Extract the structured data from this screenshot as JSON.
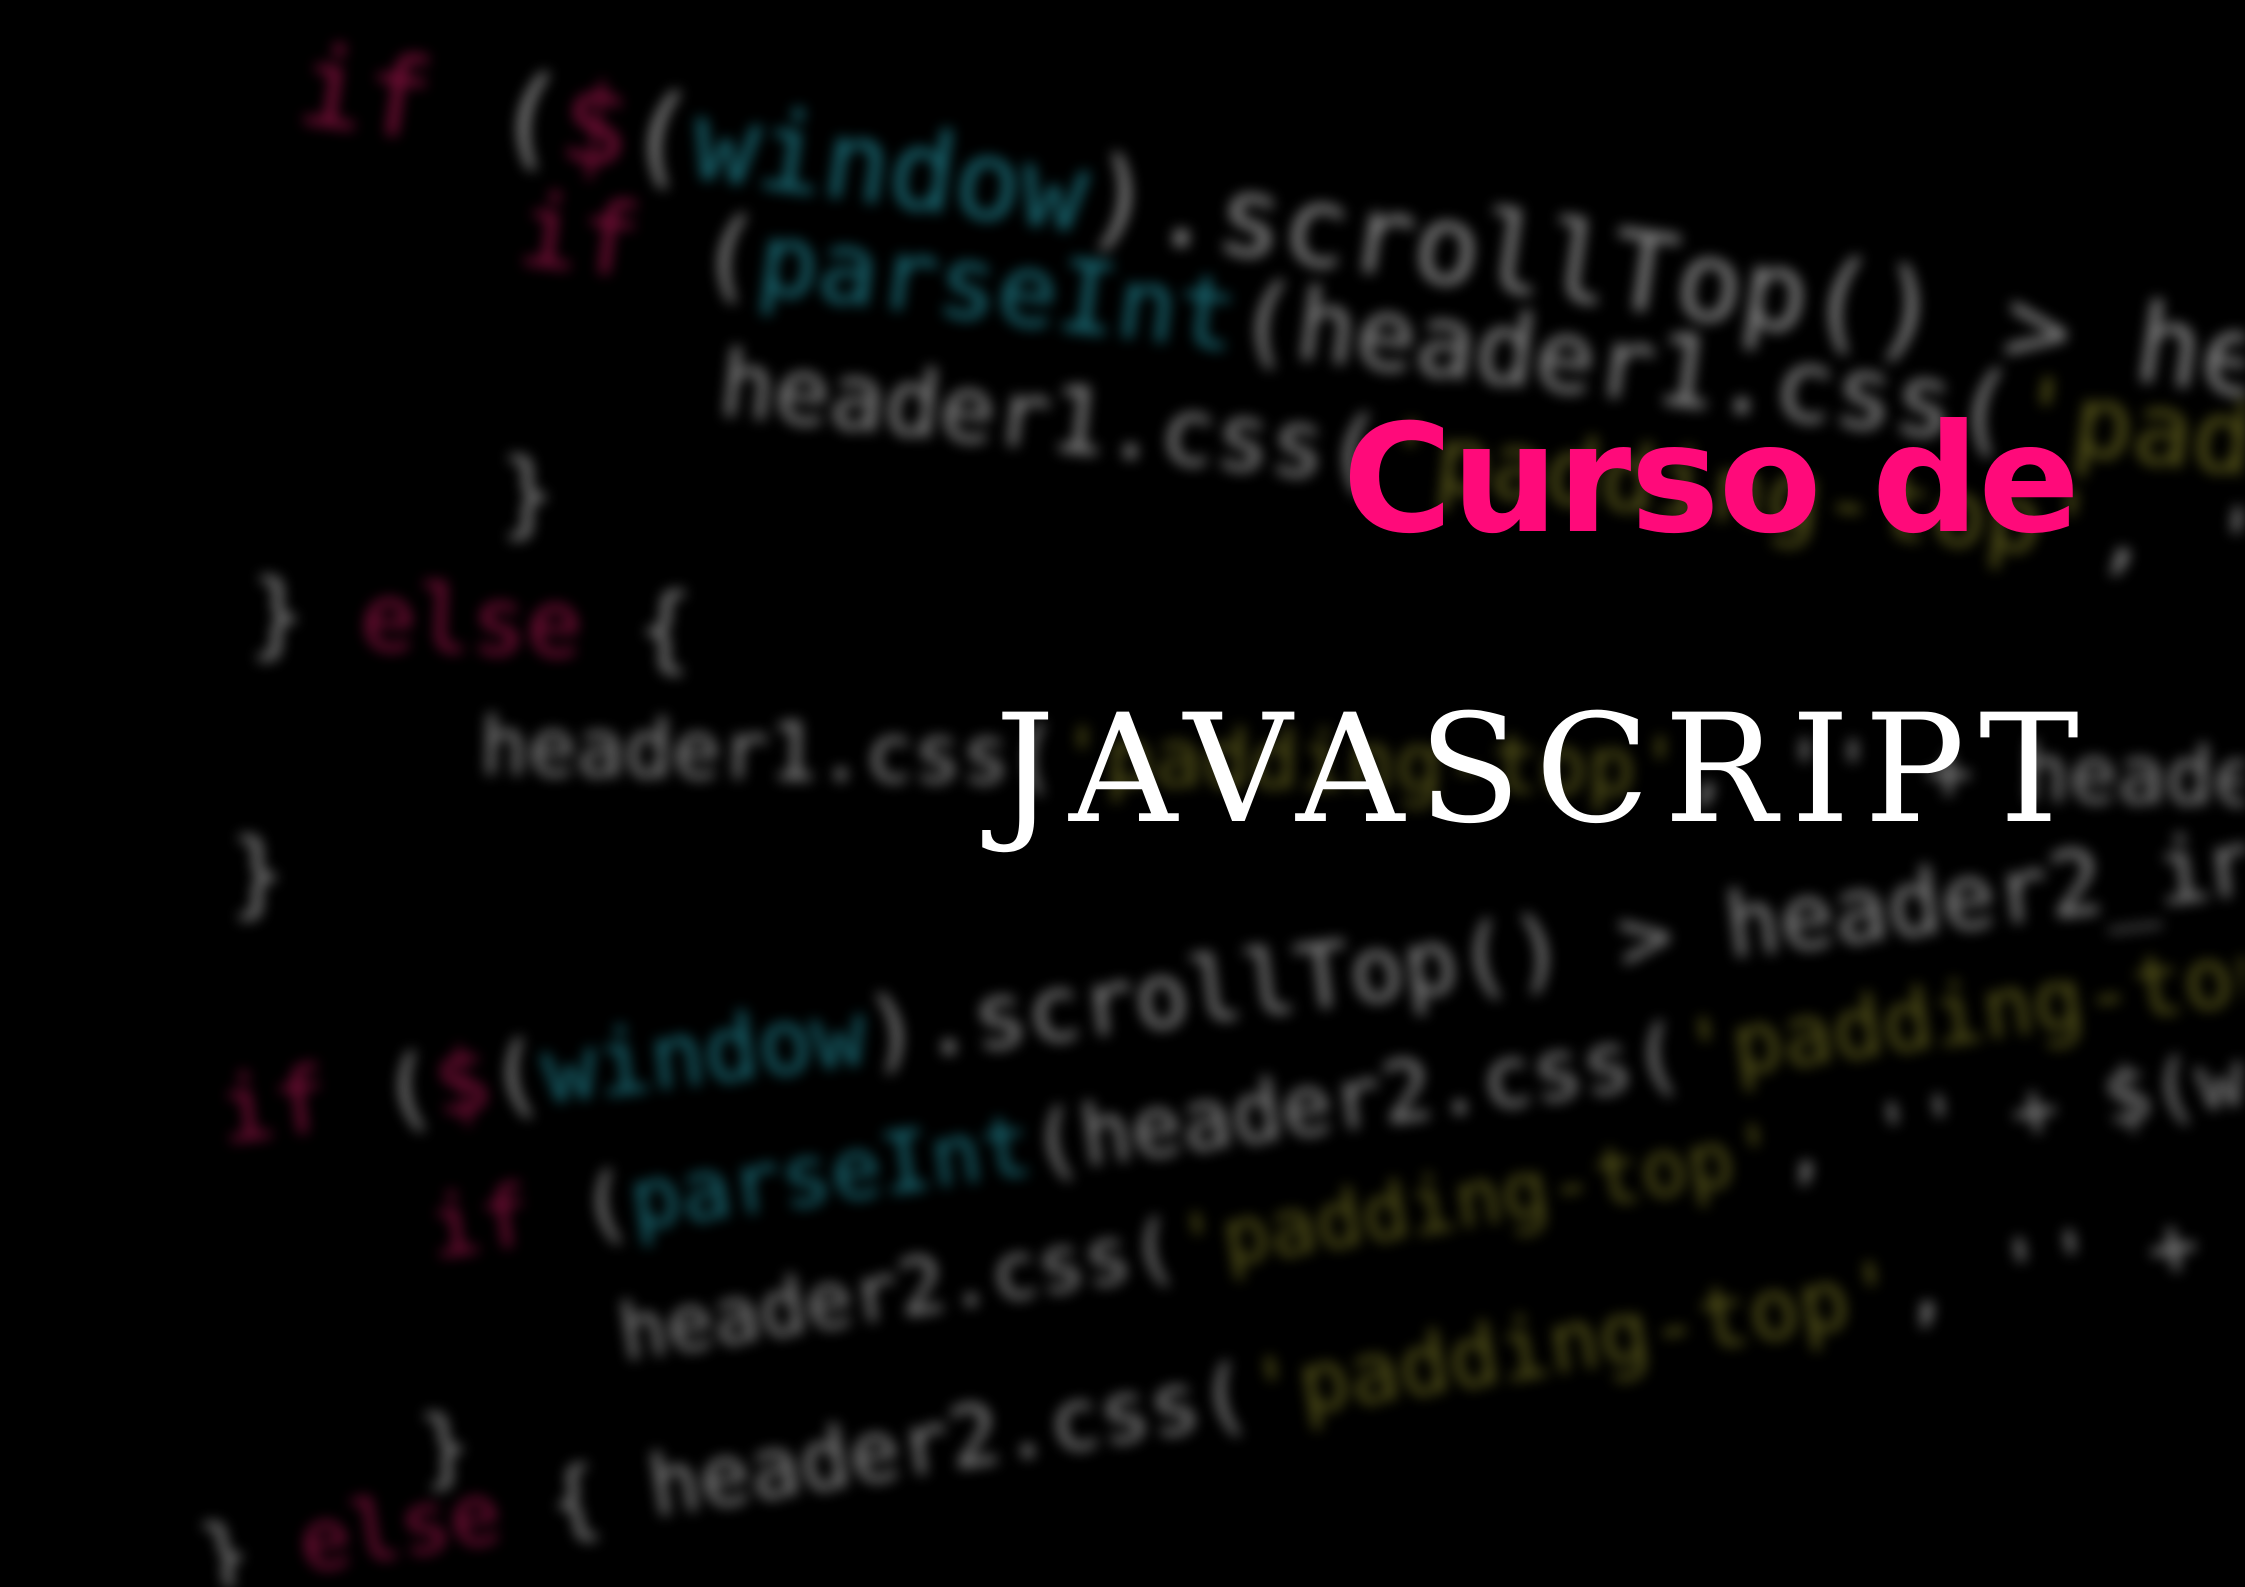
{
  "title": {
    "line1": "Curso de",
    "line2": "JAVASCRIPT",
    "line1_color": "#ff0a7a",
    "line2_color": "#ffffff"
  },
  "background": {
    "color": "#000000",
    "code_keyword_color": "#c2185b",
    "code_function_color": "#2aa8b8",
    "code_string_color": "#8c8a2a"
  }
}
